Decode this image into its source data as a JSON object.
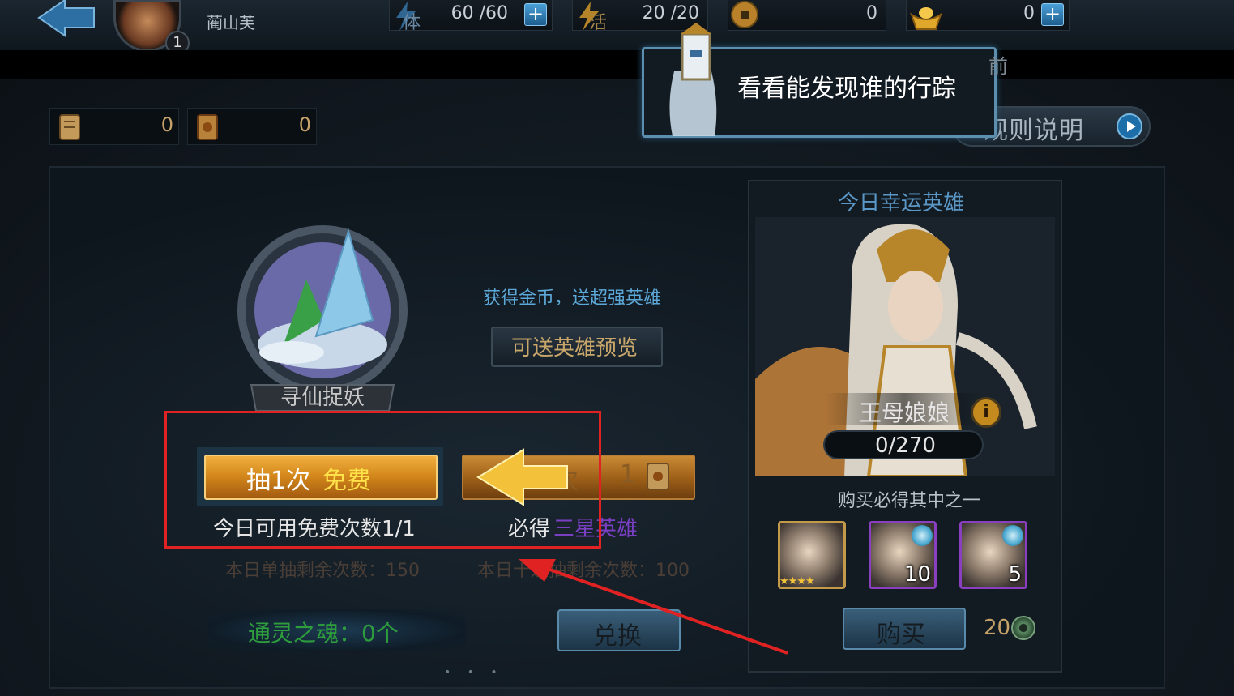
{
  "player": {
    "name": "蔺山芙",
    "level": "1"
  },
  "resources": {
    "stamina_label": "体",
    "stamina": "60 /60",
    "vitality_label": "活",
    "vitality": "20 /20",
    "copper": "0",
    "ingot": "0"
  },
  "scrolls": {
    "item1": "0",
    "item2": "0"
  },
  "rules_button": "规则说明",
  "tooltip": {
    "text": "看看能发现谁的行踪",
    "partial_hidden": "前"
  },
  "draw": {
    "emblem_text": "寻仙捉妖",
    "promo_text": "获得金币，送超强英雄",
    "preview_button": "可送英雄预览",
    "single_label": "抽1次",
    "single_free": "免费",
    "free_count_text": "今日可用免费次数1/1",
    "ten_label": "次",
    "ten_cost": "1",
    "guarantee_prefix": "必得",
    "guarantee_highlight": "三星英雄",
    "remain_single": "本日单抽剩余次数：150",
    "remain_ten": "本日十连抽剩余次数：100",
    "soul_label": "通灵之魂：0个",
    "exchange_button": "兑换"
  },
  "lucky_hero": {
    "title": "今日幸运英雄",
    "hero_name": "王母娘娘",
    "info_icon": "i",
    "shards": "0/270",
    "buy_hint": "购买必得其中之一",
    "rewards": [
      {
        "stars": "★★★★",
        "count": ""
      },
      {
        "count": "10"
      },
      {
        "count": "5"
      }
    ],
    "buy_button": "购买",
    "price": "20"
  },
  "colors": {
    "highlight_box": "#e02222",
    "guarantee": "#7b3fc4",
    "free": "#ffe24a"
  }
}
